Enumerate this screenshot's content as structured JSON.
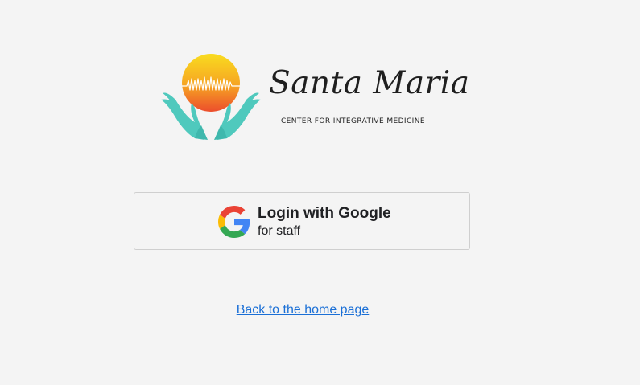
{
  "logo": {
    "name": "Santa Maria",
    "tagline": "CENTER FOR INTEGRATIVE MEDICINE",
    "icon": "sun-in-hands-logo",
    "colors": {
      "sun_top": "#f9d71c",
      "sun_bottom": "#ee4f2b",
      "hands": "#4fc9bd"
    }
  },
  "login": {
    "button_title": "Login with Google",
    "button_subtitle": "for staff",
    "icon": "google-g-icon"
  },
  "home_link": {
    "label": "Back to the home page",
    "color": "#1a6fd6"
  }
}
